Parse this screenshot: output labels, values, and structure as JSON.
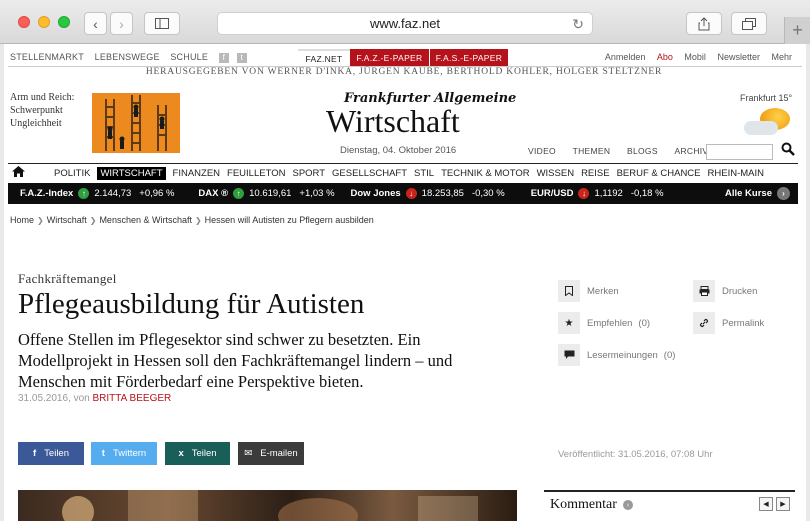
{
  "browser": {
    "url": "www.faz.net"
  },
  "top_links": {
    "left": [
      "STELLENMARKT",
      "LEBENSWEGE",
      "SCHULE"
    ],
    "social": [
      "f",
      "t"
    ],
    "editions": [
      {
        "label": "FAZ.NET",
        "bg": "#ffffff",
        "color": "#222222"
      },
      {
        "label": "F.A.Z.-E-PAPER",
        "bg": "#b5121b",
        "color": "#ffffff"
      },
      {
        "label": "F.A.S.-E-PAPER",
        "bg": "#b5121b",
        "color": "#ffffff"
      }
    ],
    "right": [
      "Anmelden",
      "Abo",
      "Mobil",
      "Newsletter",
      "Mehr"
    ]
  },
  "publisher": "HERAUSGEGEBEN VON WERNER D'INKA, JÜRGEN KAUBE, BERTHOLD KOHLER, HOLGER STELTZNER",
  "teaser": {
    "text_line1": "Arm und Reich:",
    "text_line2": "Schwerpunkt",
    "text_line3": "Ungleichheit"
  },
  "masthead": {
    "small": "Frankfurter Allgemeine",
    "big": "Wirtschaft",
    "date": "Dienstag, 04. Oktober 2016"
  },
  "subnav": [
    "VIDEO",
    "THEMEN",
    "BLOGS",
    "ARCHIV"
  ],
  "weather": "Frankfurt 15°",
  "main_nav": [
    "POLITIK",
    "WIRTSCHAFT",
    "FINANZEN",
    "FEUILLETON",
    "SPORT",
    "GESELLSCHAFT",
    "STIL",
    "TECHNIK & MOTOR",
    "WISSEN",
    "REISE",
    "BERUF & CHANCE",
    "RHEIN-MAIN"
  ],
  "ticker": {
    "items": [
      {
        "name": "F.A.Z.-Index",
        "dir": "up",
        "value": "2.144,73",
        "change": "+0,96 %"
      },
      {
        "name": "DAX ®",
        "dir": "up",
        "value": "10.619,61",
        "change": "+1,03 %"
      },
      {
        "name": "Dow Jones",
        "dir": "down",
        "value": "18.253,85",
        "change": "-0,30 %"
      },
      {
        "name": "EUR/USD",
        "dir": "down",
        "value": "1,1192",
        "change": "-0,18 %"
      }
    ],
    "all_label": "Alle Kurse"
  },
  "breadcrumb": [
    "Home",
    "Wirtschaft",
    "Menschen & Wirtschaft",
    "Hessen will Autisten zu Pflegern ausbilden"
  ],
  "article": {
    "kicker": "Fachkräftemangel",
    "headline": "Pflegeausbildung für Autisten",
    "lead_line1": "Offene Stellen im Pflegesektor sind schwer zu besetzten. Ein",
    "lead_line2": "Modellprojekt in Hessen soll den Fachkräftemangel lindern – und",
    "lead_line3": "Menschen mit Förderbedarf eine Perspektive bieten.",
    "date": "31.05.2016, von",
    "author": "BRITTA BEEGER",
    "published": "Veröffentlicht: 31.05.2016, 07:08 Uhr"
  },
  "share": [
    {
      "label": "Teilen",
      "icon": "f",
      "bg": "#3b5998"
    },
    {
      "label": "Twittern",
      "icon": "t",
      "bg": "#55acee"
    },
    {
      "label": "Teilen",
      "icon": "x",
      "bg": "#1a5e5a"
    },
    {
      "label": "E-mailen",
      "icon": "✉",
      "bg": "#3b3b3b"
    }
  ],
  "tools": {
    "merken": "Merken",
    "drucken": "Drucken",
    "empfehlen": "Empfehlen",
    "empfehlen_count": "(0)",
    "permalink": "Permalink",
    "leser": "Lesermeinungen",
    "leser_count": "(0)"
  },
  "sidebar": {
    "kommentar": "Kommentar"
  }
}
